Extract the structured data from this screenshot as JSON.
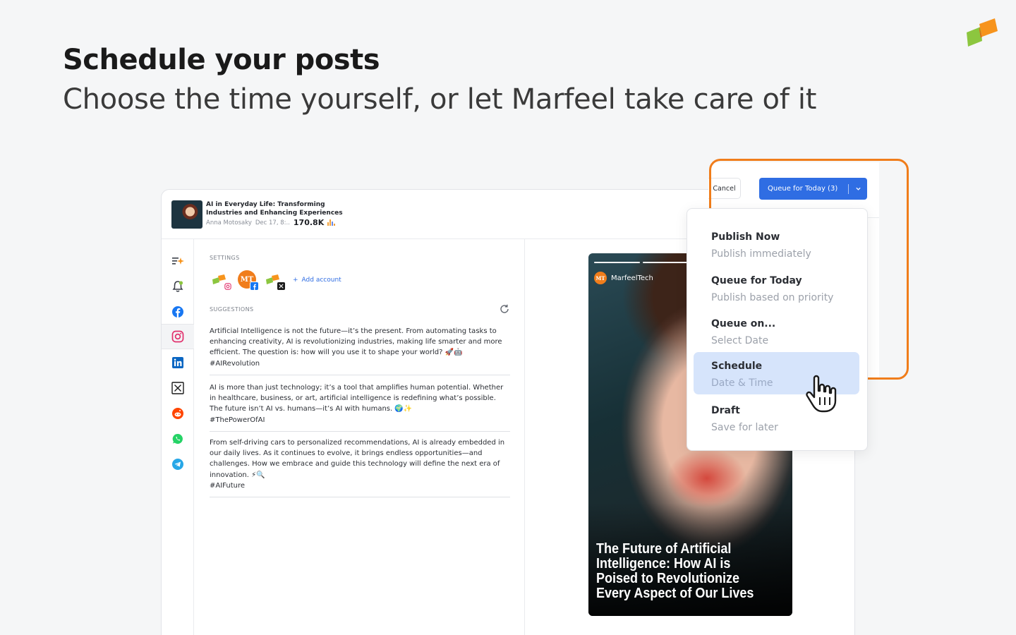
{
  "hero": {
    "title": "Schedule your posts",
    "subtitle": "Choose the time yourself, or let Marfeel take care of it"
  },
  "colors": {
    "accent": "#2f6de3",
    "highlight_frame": "#f07d1b",
    "selected_option": "#d6e4fb"
  },
  "article": {
    "title": "AI in Everyday Life: Transforming Industries and Enhancing Experiences",
    "author": "Anna Motosaky",
    "date": "Dec 17, 8:..",
    "views": "170.8K"
  },
  "rail": {
    "items": [
      "ai-sparkle-icon",
      "notification-bell-icon",
      "facebook-icon",
      "instagram-icon",
      "linkedin-icon",
      "x-icon",
      "reddit-icon",
      "whatsapp-icon",
      "telegram-icon"
    ],
    "active": "instagram-icon"
  },
  "settings": {
    "label": "SETTINGS",
    "add_account": "Add account",
    "accounts": [
      {
        "name": "marfeel-instagram",
        "badge": "instagram-icon"
      },
      {
        "name": "MarfeelTech",
        "initials": "MT",
        "badge": "facebook-icon"
      },
      {
        "name": "marfeel-x",
        "badge": "x-icon"
      }
    ]
  },
  "suggestions": {
    "label": "SUGGESTIONS",
    "items": [
      {
        "text": "Artificial Intelligence is not the future—it’s the present. From automating tasks to enhancing creativity, AI is revolutionizing industries, making life smarter and more efficient. The question is: how will you use it to shape your world? 🚀🤖",
        "tag": "#AIRevolution"
      },
      {
        "text": "AI is more than just technology; it’s a tool that amplifies human potential. Whether in healthcare, business, or art, artificial intelligence is redefining what’s possible. The future isn’t AI vs. humans—it’s AI with humans. 🌍✨",
        "tag": "#ThePowerOfAI"
      },
      {
        "text": "From self-driving cars to personalized recommendations, AI is already embedded in our daily lives. As it continues to evolve, it brings endless opportunities—and challenges. How we embrace and guide this technology will define the next era of innovation. ⚡🔍",
        "tag": "#AIFuture"
      }
    ]
  },
  "preview": {
    "account_name": "MarfeelTech",
    "account_initials": "MT",
    "headline": "The Future of Artificial Intelligence: How AI is Poised to Revolutionize Every Aspect of Our Lives"
  },
  "actions": {
    "cancel": "Cancel",
    "queue_button": "Queue for Today (3)"
  },
  "dropdown": {
    "selected": "Schedule",
    "options": [
      {
        "title": "Publish Now",
        "subtitle": "Publish immediately"
      },
      {
        "title": "Queue for Today",
        "subtitle": "Publish based on priority"
      },
      {
        "title": "Queue on...",
        "subtitle": "Select Date"
      },
      {
        "title": "Schedule",
        "subtitle": "Date & Time"
      },
      {
        "title": "Draft",
        "subtitle": "Save for later"
      }
    ]
  }
}
